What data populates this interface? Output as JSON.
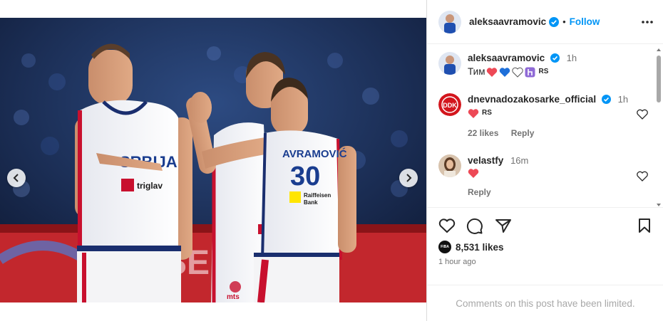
{
  "post": {
    "author": "aleksaavramovic",
    "follow_label": "Follow",
    "separator": "•"
  },
  "caption": {
    "user": "aleksaavramovic",
    "time": "1h",
    "text": "Тим",
    "flag_code": "RS"
  },
  "comments": [
    {
      "user": "dnevnadozakosarke_official",
      "time": "1h",
      "flag_code": "RS",
      "likes": "22 likes",
      "reply_label": "Reply"
    },
    {
      "user": "velastfy",
      "time": "16m",
      "reply_label": "Reply"
    }
  ],
  "stats": {
    "likes": "8,531 likes",
    "posted": "1 hour ago"
  },
  "footer": {
    "limited_notice": "Comments on this post have been limited."
  },
  "photo": {
    "jersey_left": "SRBIJA",
    "jersey_right_name": "AVRAMOVIĆ",
    "jersey_right_number": "30",
    "sponsor_left": "triglav",
    "sponsor_right": "Raiffeisen Bank",
    "mts": "mts"
  },
  "carousel": {
    "slides": 8,
    "active_index": 5
  },
  "colors": {
    "accent": "#0095f6",
    "heart": "#ed4956",
    "blue_heart": "#1e6fd9",
    "purple": "#8f6ad6"
  }
}
